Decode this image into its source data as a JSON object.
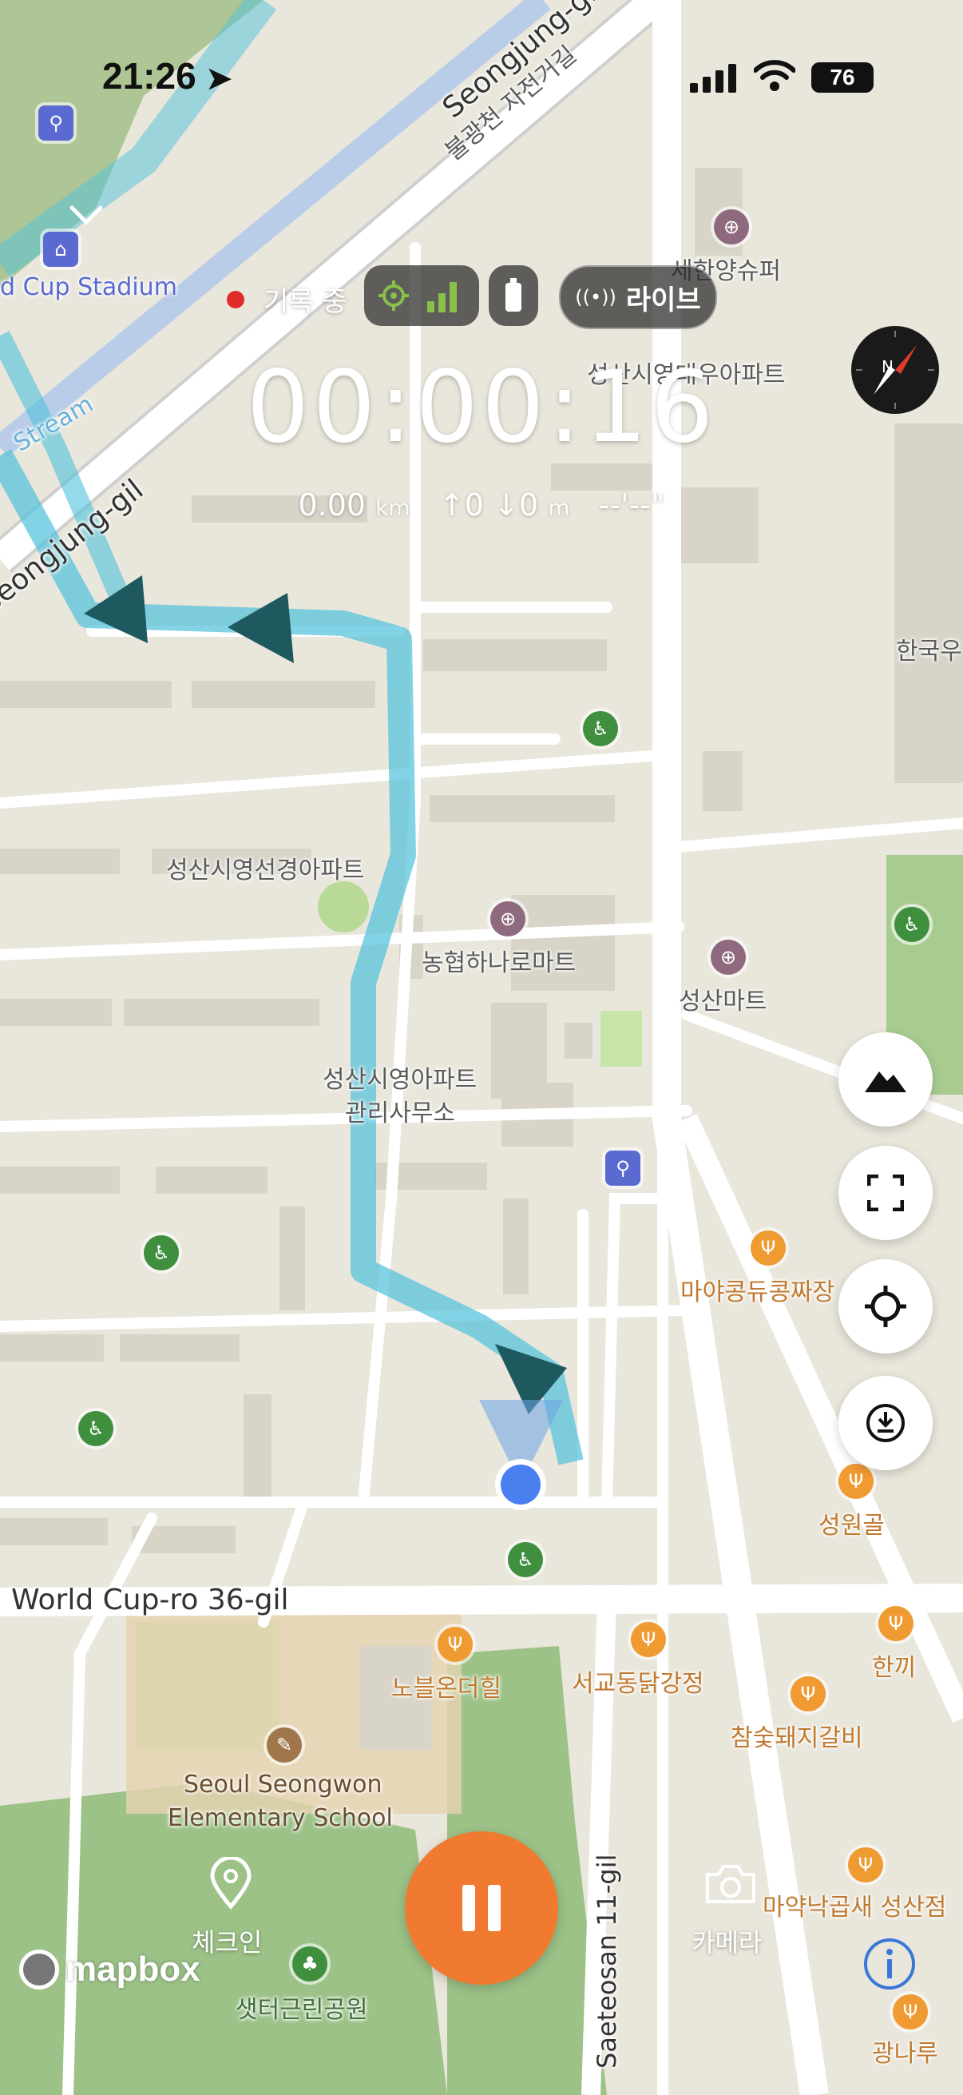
{
  "status_bar": {
    "time": "21:26",
    "battery": "76"
  },
  "recording": {
    "status_label": "기록 중",
    "live_label": "라이브",
    "elapsed": "00:00:16",
    "distance": "0.00",
    "distance_unit": "km",
    "ascent": "↑0",
    "descent": "↓0",
    "elev_unit": "m",
    "pace": "--'--\""
  },
  "map": {
    "streets": [
      "Seongjung-gil",
      "Seongjung-gil",
      "World Cup-ro 36-gil",
      "Saeteosan 11-gil",
      "불광천 자전거길",
      "d Cup Stadium",
      "Stream"
    ],
    "places": [
      "세한양슈퍼",
      "성산시영대우아파트",
      "한국우",
      "성산시영선경아파트",
      "농협하나로마트",
      "성산마트",
      "성산시영아파트",
      "관리사무소",
      "마야콩듀콩짜장",
      "성원골",
      "노블온더힐",
      "서교동닭강정",
      "한끼",
      "참숯돼지갈비",
      "Seoul Seongwon",
      "Elementary School",
      "마약낙곱새 성산점",
      "샛터근린공원",
      "광나루"
    ],
    "attribution": "mapbox"
  },
  "bottom": {
    "checkin_label": "체크인",
    "camera_label": "카메라"
  },
  "colors": {
    "accent": "#f07a30",
    "track": "#4fc1dc",
    "location": "#4a7ff0"
  }
}
